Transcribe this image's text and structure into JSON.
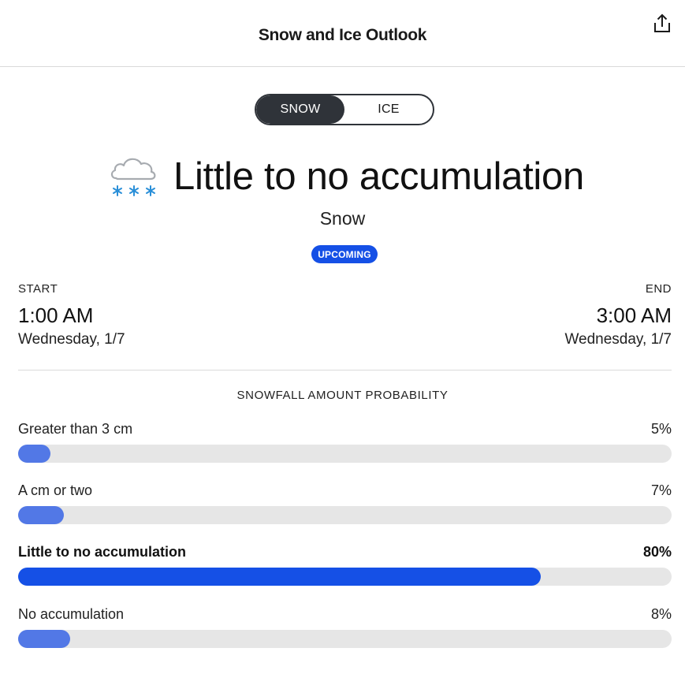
{
  "header": {
    "title": "Snow and Ice Outlook",
    "share_icon": "share-icon"
  },
  "toggle": {
    "options": [
      "SNOW",
      "ICE"
    ],
    "selected": "SNOW"
  },
  "summary": {
    "icon": "snow-cloud-icon",
    "headline": "Little to no accumulation",
    "precip_type": "Snow",
    "status_badge": "UPCOMING"
  },
  "timing": {
    "start_label": "START",
    "start_time": "1:00 AM",
    "start_date": "Wednesday, 1/7",
    "end_label": "END",
    "end_time": "3:00 AM",
    "end_date": "Wednesday, 1/7"
  },
  "probability": {
    "title": "SNOWFALL AMOUNT PROBABILITY",
    "rows": [
      {
        "label": "Greater than 3 cm",
        "percent_text": "5%",
        "percent": 5,
        "highlight": false
      },
      {
        "label": "A cm or two",
        "percent_text": "7%",
        "percent": 7,
        "highlight": false
      },
      {
        "label": "Little to no accumulation",
        "percent_text": "80%",
        "percent": 80,
        "highlight": true
      },
      {
        "label": "No accumulation",
        "percent_text": "8%",
        "percent": 8,
        "highlight": false
      }
    ]
  },
  "colors": {
    "accent": "#1550e6",
    "bar_fill": "#5278e6",
    "bar_track": "#e6e6e6",
    "toggle_active": "#2f3339",
    "snowflake": "#2a8fd8"
  }
}
